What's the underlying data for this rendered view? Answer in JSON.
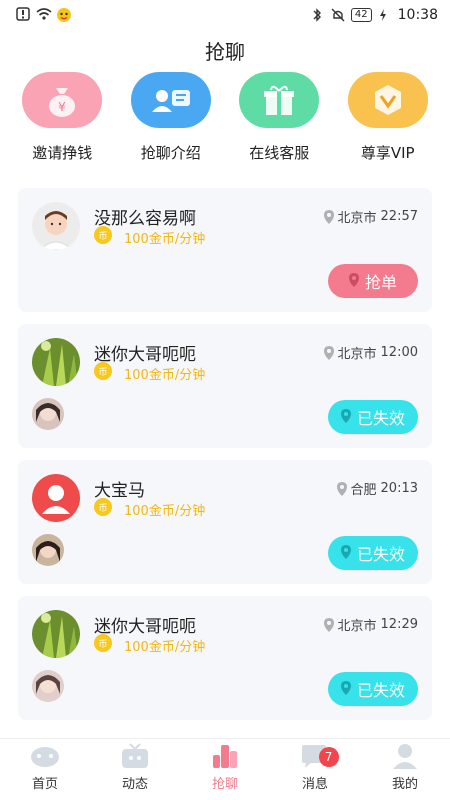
{
  "status_bar": {
    "time": "10:38",
    "battery": "42"
  },
  "page_title": "抢聊",
  "quick_actions": [
    {
      "label": "邀请挣钱",
      "icon": "money-bag-icon",
      "color": "#f9a3b4"
    },
    {
      "label": "抢聊介绍",
      "icon": "profile-card-icon",
      "color": "#4aa8f3"
    },
    {
      "label": "在线客服",
      "icon": "gift-box-icon",
      "color": "#5fdca5"
    },
    {
      "label": "尊享VIP",
      "icon": "vip-crown-icon",
      "color": "#f9c14d"
    }
  ],
  "cards": [
    {
      "name": "没那么容易啊",
      "coin": "币",
      "price": "100金币/分钟",
      "location": "北京市",
      "time": "22:57",
      "button": "抢单",
      "status": "active"
    },
    {
      "name": "迷你大哥呃呃",
      "coin": "币",
      "price": "100金币/分钟",
      "location": "北京市",
      "time": "12:00",
      "button": "已失效",
      "status": "expired"
    },
    {
      "name": "大宝马",
      "coin": "币",
      "price": "100金币/分钟",
      "location": "合肥",
      "time": "20:13",
      "button": "已失效",
      "status": "expired"
    },
    {
      "name": "迷你大哥呃呃",
      "coin": "币",
      "price": "100金币/分钟",
      "location": "北京市",
      "time": "12:29",
      "button": "已失效",
      "status": "expired"
    }
  ],
  "tabs": [
    {
      "label": "首页",
      "icon": "home-icon"
    },
    {
      "label": "动态",
      "icon": "tv-icon"
    },
    {
      "label": "抢聊",
      "icon": "grab-chat-icon",
      "active": true
    },
    {
      "label": "消息",
      "icon": "message-icon",
      "badge": "7"
    },
    {
      "label": "我的",
      "icon": "profile-icon"
    }
  ]
}
